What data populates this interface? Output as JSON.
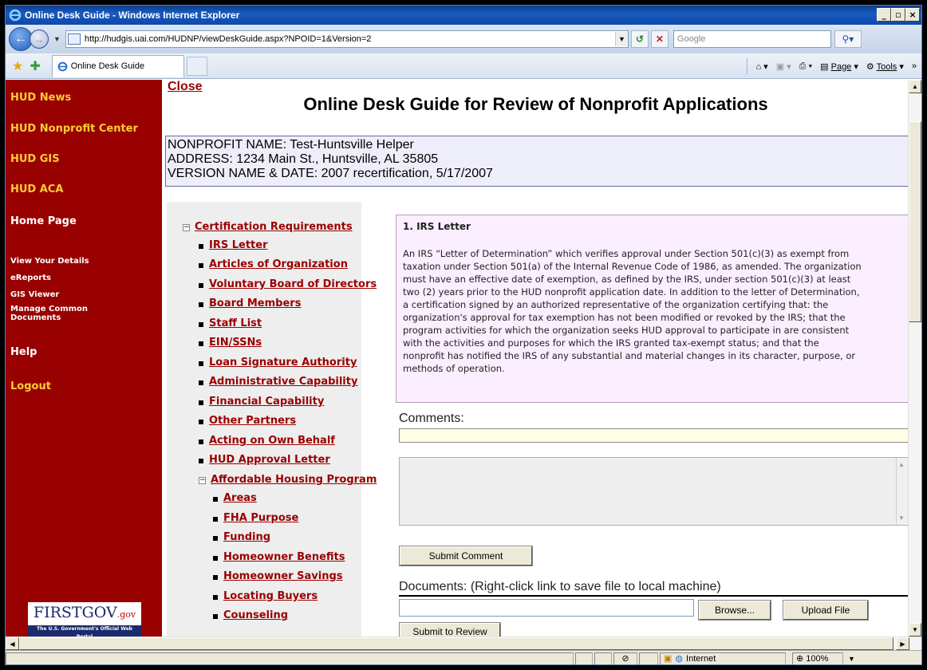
{
  "window": {
    "title": "Online Desk Guide - Windows Internet Explorer"
  },
  "address": {
    "url": "http://hudgis.uai.com/HUDNP/viewDeskGuide.aspx?NPOID=1&Version=2",
    "search_placeholder": "Google"
  },
  "tab": {
    "label": "Online Desk Guide"
  },
  "toolbar": {
    "page_label": "Page",
    "tools_label": "Tools"
  },
  "leftnav": {
    "hud_news": "HUD News",
    "nonprofit_center": "HUD Nonprofit Center",
    "gis": "HUD GIS",
    "aca": "HUD ACA",
    "home": "Home Page",
    "view_details": "View Your Details",
    "ereports": "eReports",
    "gis_viewer": "GIS Viewer",
    "manage_docs_1": "Manage Common",
    "manage_docs_2": "Documents",
    "help": "Help",
    "logout": "Logout",
    "firstgov_main": "FIRSTGOV",
    "firstgov_suffix": ".gov",
    "firstgov_tagline": "The U.S. Government's Official Web Portal"
  },
  "page": {
    "close": "Close",
    "title": "Online Desk Guide for Review of Nonprofit Applications",
    "nonprofit_name": "NONPROFIT NAME: Test-Huntsville Helper",
    "address": "ADDRESS: 1234 Main St., Huntsville, AL 35805",
    "version": "VERSION NAME & DATE: 2007 recertification, 5/17/2007"
  },
  "tree": {
    "cert_req": "Certification Requirements",
    "items": [
      "IRS Letter",
      "Articles of Organization",
      "Voluntary Board of Directors",
      "Board Members",
      "Staff List",
      "EIN/SSNs",
      "Loan Signature Authority",
      "Administrative Capability",
      "Financial Capability",
      "Other Partners",
      "Acting on Own Behalf",
      "HUD Approval Letter"
    ],
    "ahp": "Affordable Housing Program",
    "ahp_items": [
      "Areas",
      "FHA Purpose",
      "Funding",
      "Homeowner Benefits",
      "Homeowner Savings",
      "Locating Buyers",
      "Counseling"
    ]
  },
  "irs": {
    "title": "1. IRS Letter",
    "lines": [
      "An IRS “Letter of Determination” which verifies approval under Section 501(c)(3) as exempt from",
      "taxation under Section 501(a) of the Internal Revenue Code of 1986, as amended. The organization",
      "must have an effective date of exemption, as defined by the IRS, under section 501(c)(3) at least",
      "two (2) years prior to the HUD nonprofit application date. In addition to the letter of Determination,",
      "a certification signed by an authorized representative of the organization certifying that: the",
      "organization's approval for tax exemption has not been modified or revoked by the IRS; that the",
      "program activities for which the organization seeks HUD approval to participate in are consistent",
      "with the activities and purposes for which the IRS granted tax-exempt status; and that the",
      "nonprofit has notified the IRS of any substantial and material changes in its character, purpose, or",
      "methods of operation."
    ]
  },
  "comments": {
    "label": "Comments:",
    "submit": "Submit Comment"
  },
  "documents": {
    "label": "Documents: (Right-click link to save file to local machine)",
    "browse": "Browse...",
    "upload": "Upload File",
    "submit_review": "Submit to Review"
  },
  "status": {
    "zone": "Internet",
    "zoom": "100%"
  }
}
